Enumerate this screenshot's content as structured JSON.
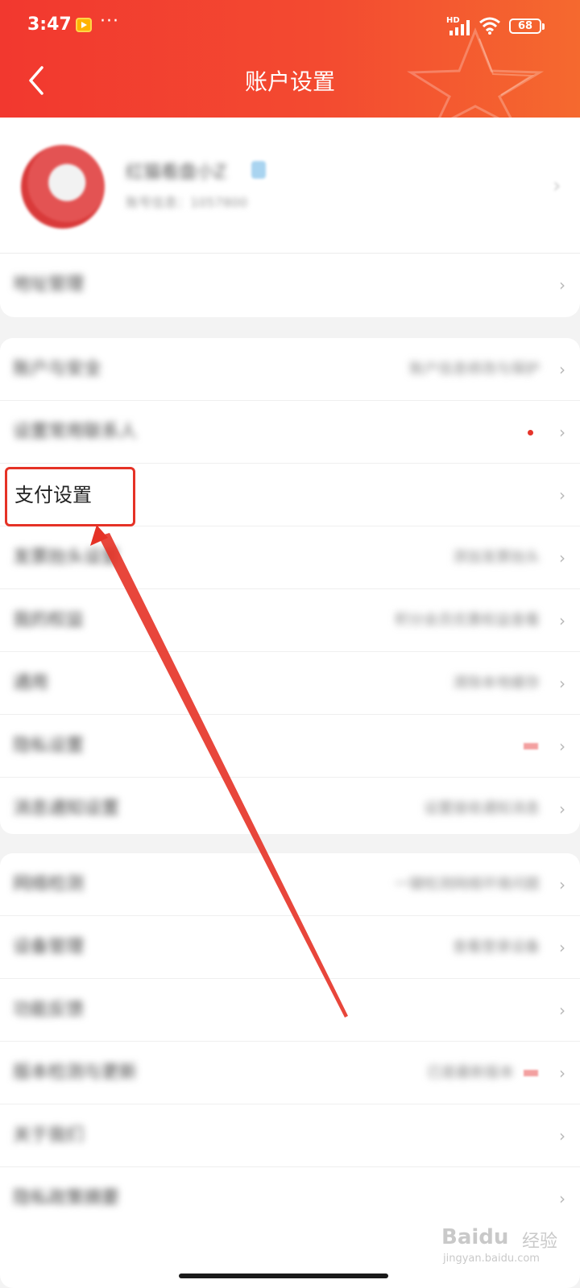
{
  "status_bar": {
    "time": "3:47",
    "dots": "···",
    "network": "HD",
    "battery": "68"
  },
  "header": {
    "title": "账户设置",
    "back_icon": "chevron-left-icon"
  },
  "profile": {
    "name": "红猫看盘小Z",
    "subtitle": "账号信息：1057800"
  },
  "rows_top": [
    {
      "label": "地址管理"
    }
  ],
  "group1": [
    {
      "label": "账户与安全",
      "value": "账户信息修改与保护"
    },
    {
      "label": "设置常用联系人",
      "value": "",
      "indicator": "red-dot"
    },
    {
      "label": "支付设置",
      "value": "",
      "highlighted": true
    },
    {
      "label": "发票抬头设置",
      "value": "添加发票抬头"
    },
    {
      "label": "我的权益",
      "value": "积分会员优惠权益查看"
    },
    {
      "label": "通用",
      "value": "清除本地缓存"
    },
    {
      "label": "隐私设置",
      "value": "",
      "indicator": "pink-tag"
    },
    {
      "label": "消息通知设置",
      "value": "设置接收通知消息"
    }
  ],
  "group2": [
    {
      "label": "网络检测",
      "value": "一键检测网络环境问题"
    },
    {
      "label": "设备管理",
      "value": "查看登录设备"
    },
    {
      "label": "功能反馈",
      "value": ""
    },
    {
      "label": "版本检测与更新",
      "value": "已是最新版本",
      "indicator": "pink-tag"
    },
    {
      "label": "关于我们",
      "value": ""
    },
    {
      "label": "隐私政策摘要",
      "value": ""
    }
  ],
  "annotation": {
    "color": "#e53226"
  },
  "watermark": {
    "main": "Baidu",
    "cn": "经验",
    "sub": "jingyan.baidu.com"
  },
  "colors": {
    "header_start": "#f2382f",
    "header_end": "#f5692f",
    "accent_red": "#e5352b",
    "background": "#f3f3f3"
  }
}
